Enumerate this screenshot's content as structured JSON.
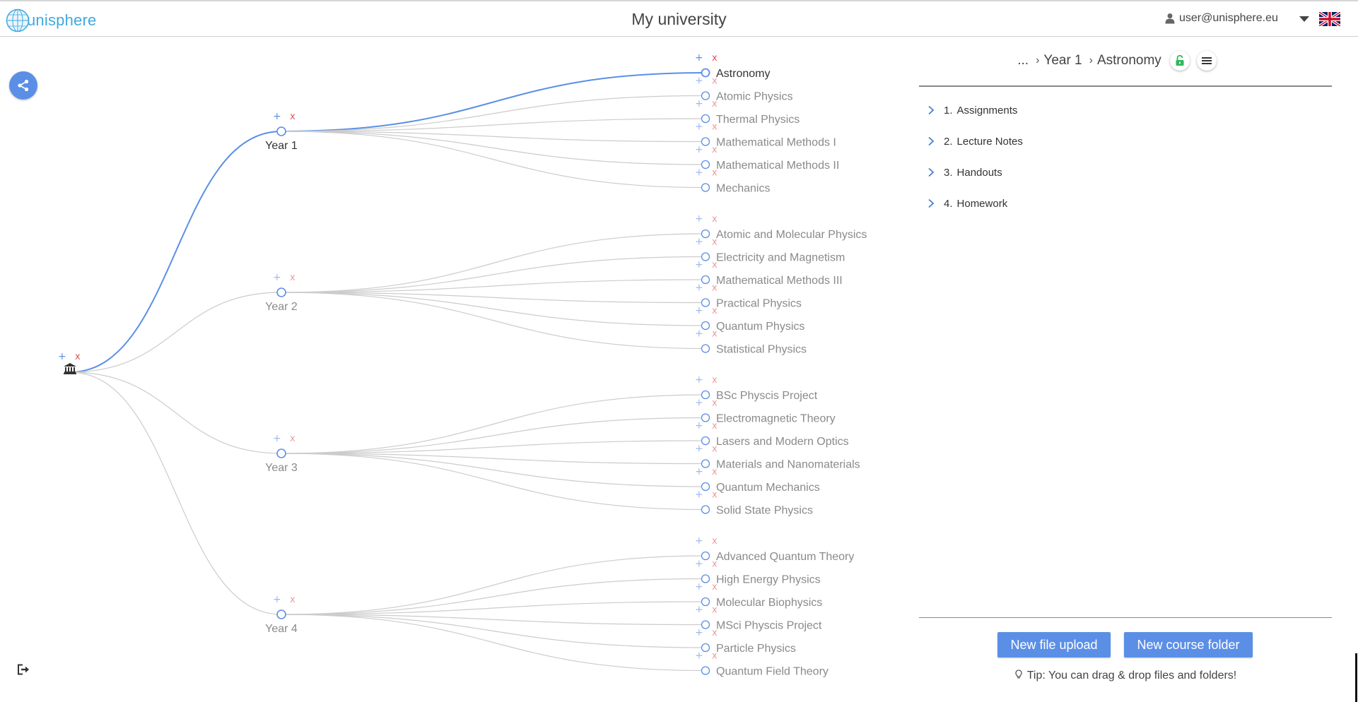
{
  "header": {
    "logo_prefix": "uni",
    "logo_suffix": "sphere",
    "title": "My university",
    "user_email": "user@unisphere.eu"
  },
  "tree": {
    "root_icon": "university-building-icon",
    "years": [
      {
        "label": "Year 1",
        "active": true,
        "courses": [
          "Astronomy",
          "Atomic Physics",
          "Thermal Physics",
          "Mathematical Methods I",
          "Mathematical Methods II",
          "Mechanics"
        ]
      },
      {
        "label": "Year 2",
        "active": false,
        "courses": [
          "Atomic and Molecular Physics",
          "Electricity and Magnetism",
          "Mathematical Methods III",
          "Practical Physics",
          "Quantum Physics",
          "Statistical Physics"
        ]
      },
      {
        "label": "Year 3",
        "active": false,
        "courses": [
          "BSc Physcis Project",
          "Electromagnetic Theory",
          "Lasers and Modern Optics",
          "Materials and Nanomaterials",
          "Quantum Mechanics",
          "Solid State Physics"
        ]
      },
      {
        "label": "Year 4",
        "active": false,
        "courses": [
          "Advanced Quantum Theory",
          "High Energy Physics",
          "Molecular Biophysics",
          "MSci Physcis Project",
          "Particle Physics",
          "Quantum Field Theory"
        ]
      }
    ],
    "active_course": "Astronomy",
    "add_symbol": "+",
    "remove_symbol": "x",
    "colors": {
      "active_link": "#5b8fe6",
      "inactive_link": "#cccccc",
      "add": "#5b8fe6",
      "remove": "#e05252"
    }
  },
  "breadcrumb": {
    "ellipsis": "...",
    "items": [
      "Year 1",
      "Astronomy"
    ],
    "separator": "›"
  },
  "folders": [
    {
      "num": "1.",
      "name": "Assignments"
    },
    {
      "num": "2.",
      "name": "Lecture Notes"
    },
    {
      "num": "3.",
      "name": "Handouts"
    },
    {
      "num": "4.",
      "name": "Homework"
    }
  ],
  "buttons": {
    "upload": "New file upload",
    "new_folder": "New course folder"
  },
  "tip": "Tip: You can drag & drop files and folders!",
  "icons": [
    "share-icon",
    "logout-icon",
    "user-icon",
    "caret-down-icon",
    "uk-flag-icon",
    "unlock-icon",
    "menu-icon",
    "chevron-right-icon",
    "lightbulb-icon"
  ]
}
